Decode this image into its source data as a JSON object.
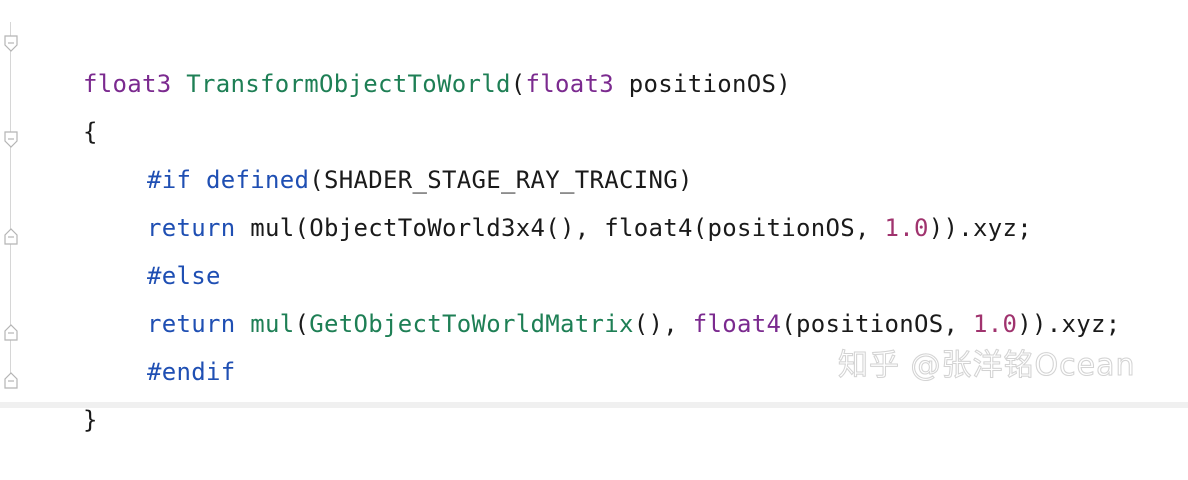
{
  "colors": {
    "type": "#7b2a8f",
    "function": "#1e7f55",
    "keyword": "#1f4fb3",
    "number": "#a0336e",
    "plain": "#1a1a1a"
  },
  "code": {
    "line1": {
      "t1": "float3",
      "t2": " ",
      "t3": "TransformObjectToWorld",
      "t4": "(",
      "t5": "float3",
      "t6": " positionOS)"
    },
    "line2": {
      "t1": "{"
    },
    "line3": {
      "t1": "#if",
      "t2": " ",
      "t3": "defined",
      "t4": "(SHADER_STAGE_RAY_TRACING)"
    },
    "line4": {
      "t1": "return",
      "t2": " mul(ObjectToWorld3x4(), float4(positionOS, ",
      "t3": "1.0",
      "t4": ")).xyz;"
    },
    "line5": {
      "t1": "#else"
    },
    "line6": {
      "t1": "return",
      "t2": " ",
      "t3": "mul",
      "t4": "(",
      "t5": "GetObjectToWorldMatrix",
      "t6": "(), ",
      "t7": "float4",
      "t8": "(positionOS, ",
      "t9": "1.0",
      "t10": ")).xyz;"
    },
    "line7": {
      "t1": "#endif"
    },
    "line8": {
      "t1": "}"
    }
  },
  "watermark": {
    "text": "知乎 @张洋铭Ocean"
  },
  "icons": {
    "fold_open": "fold-open-icon",
    "fold_close": "fold-close-icon"
  }
}
